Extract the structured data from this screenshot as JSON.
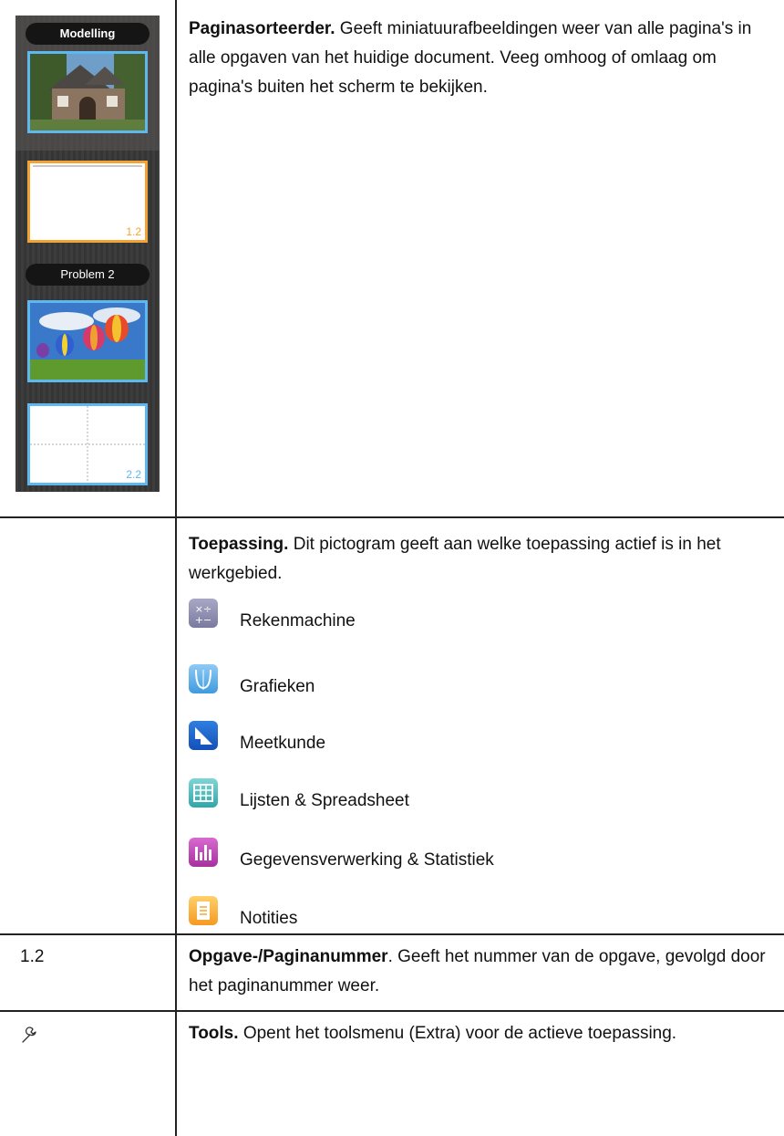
{
  "sorter": {
    "problem1_label": "Modelling",
    "problem2_label": "Problem 2",
    "page_1_2": "1.2",
    "page_2_2": "2.2"
  },
  "row1": {
    "title": "Paginasorteerder.",
    "text": " Geeft miniatuurafbeeldingen weer van alle pagina's in alle opgaven van het huidige document. Veeg omhoog of omlaag om pagina's buiten het scherm te bekijken."
  },
  "row2": {
    "title": "Toepassing.",
    "text": " Dit pictogram geeft aan welke toepassing actief is in het werkgebied.",
    "apps": [
      {
        "label": "Rekenmachine",
        "icon": "calculator-icon"
      },
      {
        "label": "Grafieken",
        "icon": "graphs-icon"
      },
      {
        "label": "Meetkunde",
        "icon": "geometry-icon"
      },
      {
        "label": "Lijsten & Spreadsheet",
        "icon": "lists-spreadsheet-icon"
      },
      {
        "label": "Gegevensverwerking & Statistiek",
        "icon": "data-statistics-icon"
      },
      {
        "label": "Notities",
        "icon": "notes-icon"
      }
    ]
  },
  "row3": {
    "left": "1.2",
    "title": "Opgave-/Paginanummer",
    "text": ". Geeft het nummer van de opgave, gevolgd door het paginanummer weer."
  },
  "row4": {
    "left_icon": "wrench-icon",
    "title": "Tools.",
    "text": " Opent het toolsmenu (Extra) voor de actieve toepassing."
  }
}
